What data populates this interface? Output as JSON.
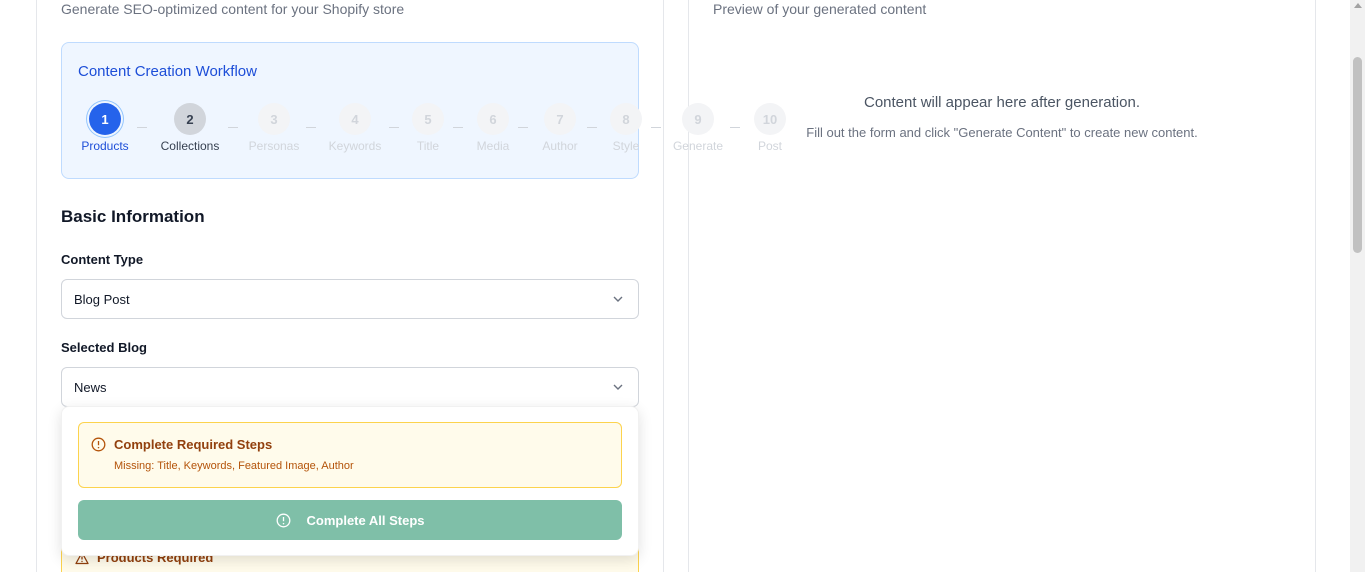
{
  "left": {
    "subtitle": "Generate SEO-optimized content for your Shopify store"
  },
  "right": {
    "subtitle": "Preview of your generated content",
    "empty_title": "Content will appear here after generation.",
    "empty_subtitle": "Fill out the form and click \"Generate Content\" to create new content."
  },
  "workflow": {
    "title": "Content Creation Workflow",
    "steps": [
      {
        "number": "1",
        "label": "Products",
        "state": "active"
      },
      {
        "number": "2",
        "label": "Collections",
        "state": "done"
      },
      {
        "number": "3",
        "label": "Personas",
        "state": "pending"
      },
      {
        "number": "4",
        "label": "Keywords",
        "state": "pending"
      },
      {
        "number": "5",
        "label": "Title",
        "state": "pending"
      },
      {
        "number": "6",
        "label": "Media",
        "state": "pending"
      },
      {
        "number": "7",
        "label": "Author",
        "state": "pending"
      },
      {
        "number": "8",
        "label": "Style",
        "state": "pending"
      },
      {
        "number": "9",
        "label": "Generate",
        "state": "pending"
      },
      {
        "number": "10",
        "label": "Post",
        "state": "pending"
      }
    ]
  },
  "form": {
    "section_title": "Basic Information",
    "content_type_label": "Content Type",
    "content_type_value": "Blog Post",
    "blog_label": "Selected Blog",
    "blog_value": "News"
  },
  "popover": {
    "warning_title": "Complete Required Steps",
    "warning_text": "Missing: Title, Keywords, Featured Image, Author",
    "button_label": "Complete All Steps"
  },
  "products_required": {
    "title": "Products Required"
  },
  "colors": {
    "accent": "#2563eb",
    "warning": "#92400e",
    "cta": "#7fbfa8"
  }
}
